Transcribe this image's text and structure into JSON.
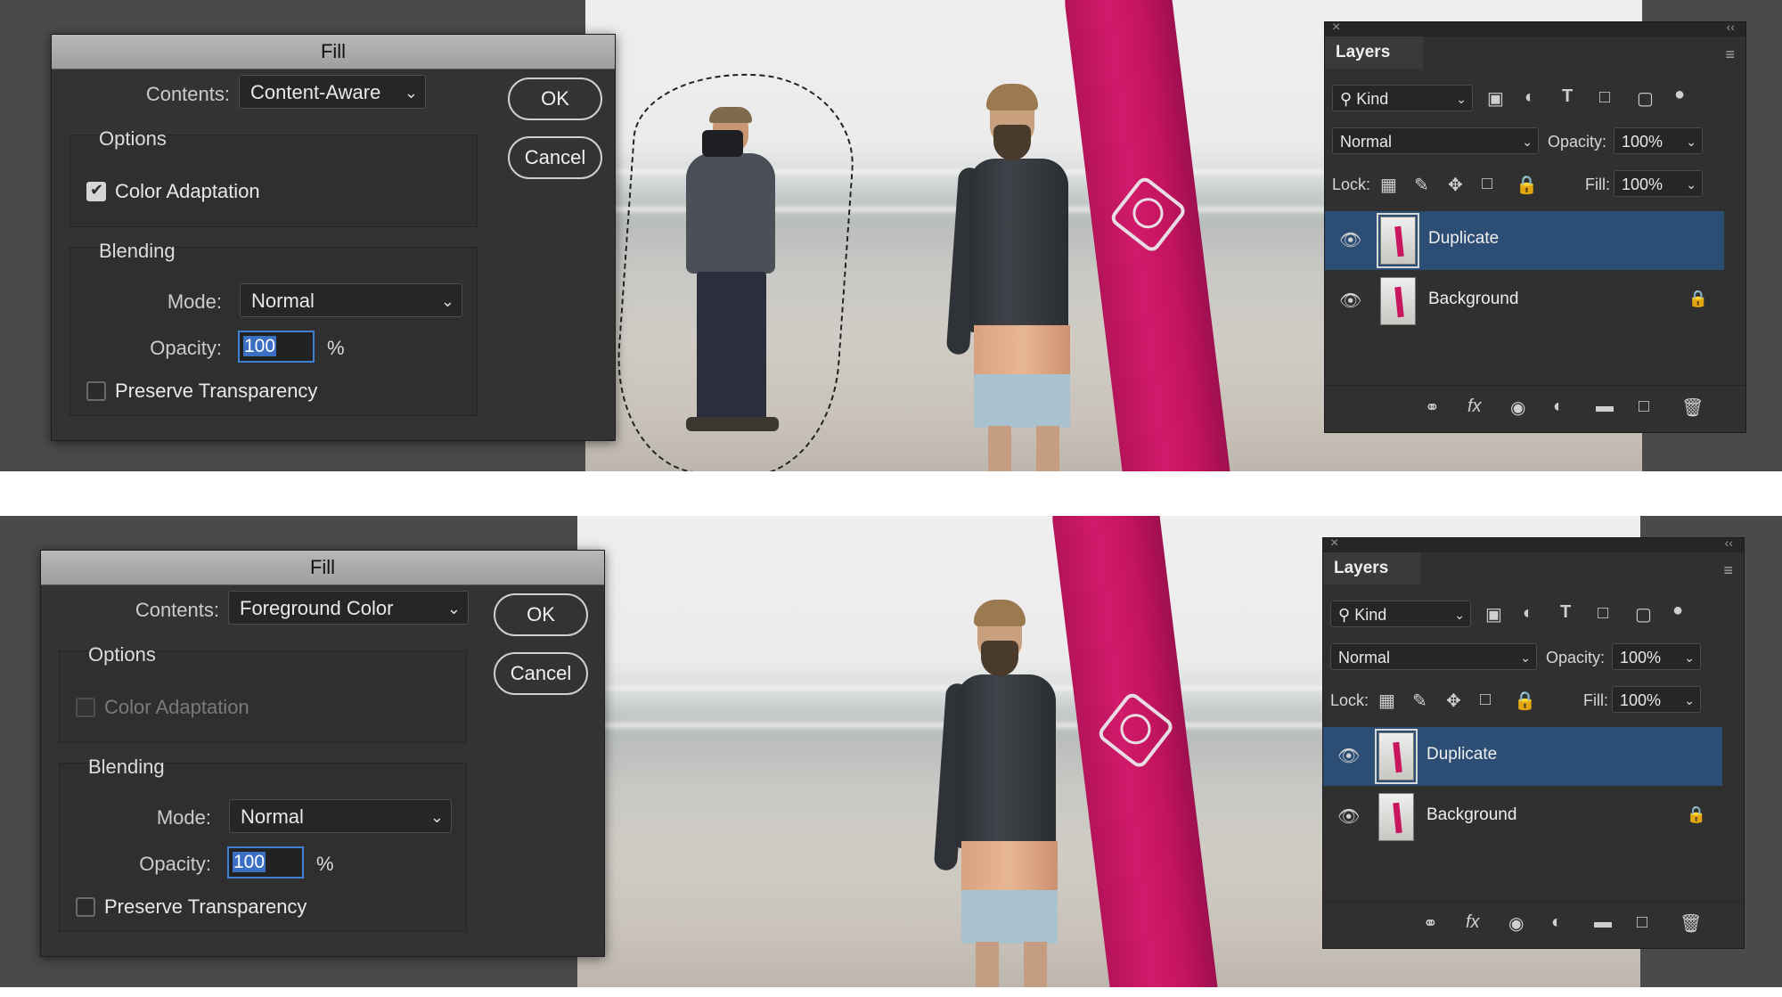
{
  "panels": [
    {
      "fill_dialog": {
        "title": "Fill",
        "contents_label": "Contents:",
        "contents_value": "Content-Aware",
        "ok_label": "OK",
        "cancel_label": "Cancel",
        "options_title": "Options",
        "color_adaptation_label": "Color Adaptation",
        "color_adaptation_checked": true,
        "blending_title": "Blending",
        "mode_label": "Mode:",
        "mode_value": "Normal",
        "opacity_label": "Opacity:",
        "opacity_value": "100",
        "opacity_unit": "%",
        "preserve_transparency_label": "Preserve Transparency"
      },
      "layers_panel": {
        "tab_label": "Layers",
        "filter_value": "Kind",
        "blend_mode": "Normal",
        "opacity_label": "Opacity:",
        "opacity_value": "100%",
        "lock_label": "Lock:",
        "fill_label": "Fill:",
        "fill_value": "100%",
        "layers": [
          {
            "name": "Duplicate",
            "selected": true,
            "locked": false
          },
          {
            "name": "Background",
            "selected": false,
            "locked": true
          }
        ]
      }
    },
    {
      "fill_dialog": {
        "title": "Fill",
        "contents_label": "Contents:",
        "contents_value": "Foreground Color",
        "ok_label": "OK",
        "cancel_label": "Cancel",
        "options_title": "Options",
        "color_adaptation_label": "Color Adaptation",
        "color_adaptation_checked": false,
        "blending_title": "Blending",
        "mode_label": "Mode:",
        "mode_value": "Normal",
        "opacity_label": "Opacity:",
        "opacity_value": "100",
        "opacity_unit": "%",
        "preserve_transparency_label": "Preserve Transparency"
      },
      "layers_panel": {
        "tab_label": "Layers",
        "filter_value": "Kind",
        "blend_mode": "Normal",
        "opacity_label": "Opacity:",
        "opacity_value": "100%",
        "lock_label": "Lock:",
        "fill_label": "Fill:",
        "fill_value": "100%",
        "layers": [
          {
            "name": "Duplicate",
            "selected": true,
            "locked": false
          },
          {
            "name": "Background",
            "selected": false,
            "locked": true
          }
        ]
      }
    }
  ],
  "icons": {
    "close": "close-icon",
    "collapse": "collapse-icon",
    "panel_menu": "panel-menu-icon",
    "search": "search-icon",
    "filter_pixel": "image-filter-icon",
    "filter_adjustment": "adjustment-filter-icon",
    "filter_type": "type-filter-icon",
    "filter_shape": "shape-filter-icon",
    "filter_smart": "smart-object-filter-icon",
    "lock_transparent": "lock-transparent-pixels-icon",
    "lock_image": "lock-image-pixels-icon",
    "lock_position": "lock-position-icon",
    "lock_artboard": "lock-artboard-icon",
    "lock_all": "lock-all-icon",
    "eye": "eye-icon",
    "link": "link-layers-icon",
    "fx": "layer-style-icon",
    "mask": "add-mask-icon",
    "adjustment": "new-adjustment-icon",
    "group": "new-group-icon",
    "new_layer": "new-layer-icon",
    "delete": "trash-icon"
  },
  "colors": {
    "selection_blue": "#2d4e74",
    "surfboard_pink": "#d11a6b",
    "input_focus_blue": "#3f7fd4"
  }
}
